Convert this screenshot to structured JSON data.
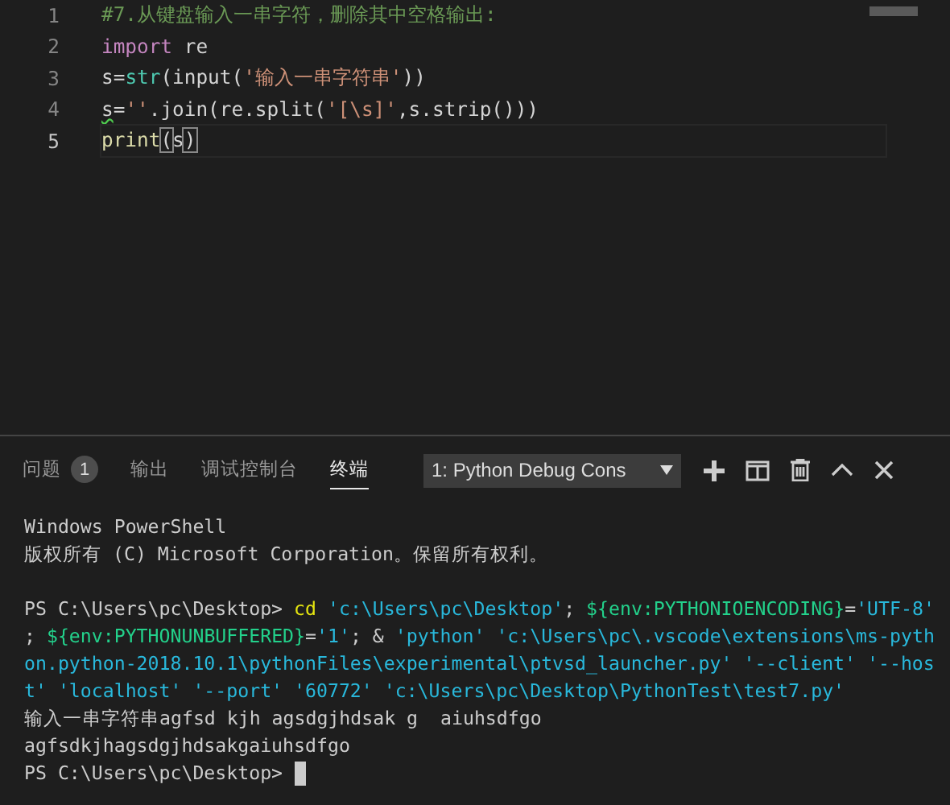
{
  "editor": {
    "lines": [
      {
        "number": "1",
        "current": false,
        "tokens": [
          {
            "text": "#7.从键盘输入一串字符，删除其中空格输出:",
            "kind": "comment"
          }
        ]
      },
      {
        "number": "2",
        "current": false,
        "tokens": [
          {
            "text": "import",
            "kind": "keyword"
          },
          {
            "text": " re",
            "kind": "plain"
          }
        ]
      },
      {
        "number": "3",
        "current": false,
        "tokens": [
          {
            "text": "s=",
            "kind": "plain"
          },
          {
            "text": "str",
            "kind": "builtin"
          },
          {
            "text": "(input(",
            "kind": "plain"
          },
          {
            "text": "'输入一串字符串'",
            "kind": "string"
          },
          {
            "text": "))",
            "kind": "plain"
          }
        ]
      },
      {
        "number": "4",
        "current": false,
        "tokens": [
          {
            "text": "s",
            "kind": "warning"
          },
          {
            "text": "=",
            "kind": "plain"
          },
          {
            "text": "''",
            "kind": "string"
          },
          {
            "text": ".join(re.split(",
            "kind": "plain"
          },
          {
            "text": "'[\\s]'",
            "kind": "string"
          },
          {
            "text": ",s.strip()))",
            "kind": "plain"
          }
        ]
      },
      {
        "number": "5",
        "current": true,
        "tokens": [
          {
            "text": "print",
            "kind": "function"
          },
          {
            "text": "(",
            "kind": "bracket-match"
          },
          {
            "text": "s",
            "kind": "plain"
          },
          {
            "text": ")",
            "kind": "bracket-match"
          }
        ]
      }
    ]
  },
  "panel": {
    "tabs": [
      {
        "label": "问题",
        "badge": "1",
        "selected": false
      },
      {
        "label": "输出",
        "selected": false
      },
      {
        "label": "调试控制台",
        "selected": false
      },
      {
        "label": "终端",
        "selected": true
      }
    ],
    "terminal_select": {
      "value": "1: Python Debug Cons"
    },
    "terminal": {
      "blocks": [
        {
          "lines": [
            {
              "tokens": [
                {
                  "text": "Windows PowerShell",
                  "kind": "plain"
                }
              ]
            },
            {
              "tokens": [
                {
                  "text": "版权所有 (C) Microsoft Corporation。保留所有权利。",
                  "kind": "plain"
                }
              ]
            }
          ]
        },
        {
          "lines": [
            {
              "tokens": [
                {
                  "text": "PS C:\\Users\\pc\\Desktop>",
                  "kind": "plain"
                },
                {
                  "text": " cd",
                  "kind": "command"
                },
                {
                  "text": " 'c:\\Users\\pc\\Desktop'",
                  "kind": "string"
                },
                {
                  "text": "; ",
                  "kind": "plain"
                },
                {
                  "text": "${env:PYTHONIOENCODING}",
                  "kind": "variable"
                },
                {
                  "text": "=",
                  "kind": "plain"
                },
                {
                  "text": "'UTF-8'",
                  "kind": "string"
                }
              ]
            },
            {
              "tokens": [
                {
                  "text": "; ",
                  "kind": "plain"
                },
                {
                  "text": "${env:PYTHONUNBUFFERED}",
                  "kind": "variable"
                },
                {
                  "text": "=",
                  "kind": "plain"
                },
                {
                  "text": "'1'",
                  "kind": "string"
                },
                {
                  "text": "; & ",
                  "kind": "plain"
                },
                {
                  "text": "'python'",
                  "kind": "string"
                },
                {
                  "text": " 'c:\\Users\\pc\\.vscode\\extensions\\ms-pyth",
                  "kind": "string"
                }
              ]
            },
            {
              "tokens": [
                {
                  "text": "on.python-2018.10.1\\pythonFiles\\experimental\\ptvsd_launcher.py' '--client' '--hos",
                  "kind": "string"
                }
              ]
            },
            {
              "tokens": [
                {
                  "text": "t' 'localhost' '--port' '60772' 'c:\\Users\\pc\\Desktop\\PythonTest\\test7.py'",
                  "kind": "string"
                }
              ]
            },
            {
              "tokens": [
                {
                  "text": "输入一串字符串agfsd kjh agsdgjhdsak g  aiuhsdfgo",
                  "kind": "plain"
                }
              ]
            },
            {
              "tokens": [
                {
                  "text": "agfsdkjhagsdgjhdsakgaiuhsdfgo",
                  "kind": "plain"
                }
              ]
            },
            {
              "tokens": [
                {
                  "text": "PS C:\\Users\\pc\\Desktop>",
                  "kind": "plain"
                }
              ],
              "cursor": true
            }
          ]
        }
      ]
    }
  }
}
